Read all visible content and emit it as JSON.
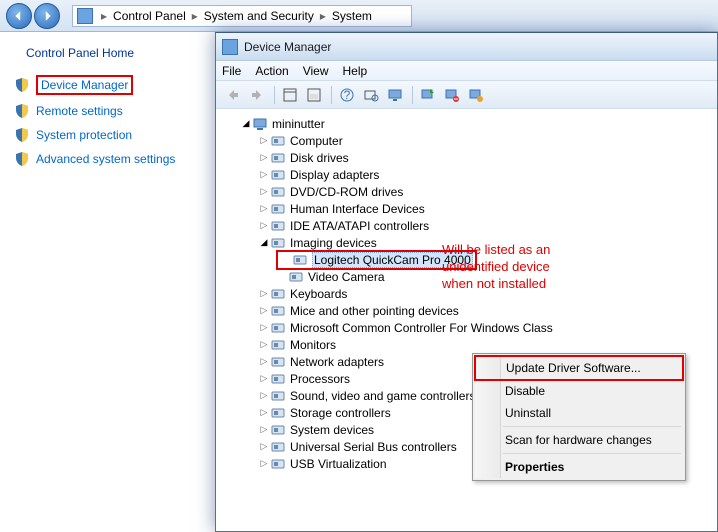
{
  "breadcrumb": {
    "items": [
      "Control Panel",
      "System and Security",
      "System"
    ]
  },
  "left_panel": {
    "home": "Control Panel Home",
    "items": [
      {
        "label": "Device Manager",
        "highlight": true
      },
      {
        "label": "Remote settings",
        "highlight": false
      },
      {
        "label": "System protection",
        "highlight": false
      },
      {
        "label": "Advanced system settings",
        "highlight": false
      }
    ]
  },
  "device_manager": {
    "title": "Device Manager",
    "menu": [
      "File",
      "Action",
      "View",
      "Help"
    ],
    "root": "mininutter",
    "nodes": [
      {
        "label": "Computer"
      },
      {
        "label": "Disk drives"
      },
      {
        "label": "Display adapters"
      },
      {
        "label": "DVD/CD-ROM drives"
      },
      {
        "label": "Human Interface Devices"
      },
      {
        "label": "IDE ATA/ATAPI controllers"
      },
      {
        "label": "Imaging devices",
        "expanded": true,
        "children": [
          {
            "label": "Logitech QuickCam Pro 4000",
            "selected": true,
            "highlight": true
          },
          {
            "label": "Video Camera"
          }
        ]
      },
      {
        "label": "Keyboards"
      },
      {
        "label": "Mice and other pointing devices"
      },
      {
        "label": "Microsoft Common Controller For Windows Class"
      },
      {
        "label": "Monitors"
      },
      {
        "label": "Network adapters"
      },
      {
        "label": "Processors"
      },
      {
        "label": "Sound, video and game controllers"
      },
      {
        "label": "Storage controllers"
      },
      {
        "label": "System devices"
      },
      {
        "label": "Universal Serial Bus controllers"
      },
      {
        "label": "USB Virtualization"
      }
    ]
  },
  "context_menu": {
    "items": [
      {
        "label": "Update Driver Software...",
        "highlight": true
      },
      {
        "label": "Disable"
      },
      {
        "label": "Uninstall"
      },
      {
        "sep": true
      },
      {
        "label": "Scan for hardware changes"
      },
      {
        "sep": true
      },
      {
        "label": "Properties",
        "bold": true
      }
    ]
  },
  "annotation": "Will be listed as an\nunidentified device\nwhen not installed"
}
